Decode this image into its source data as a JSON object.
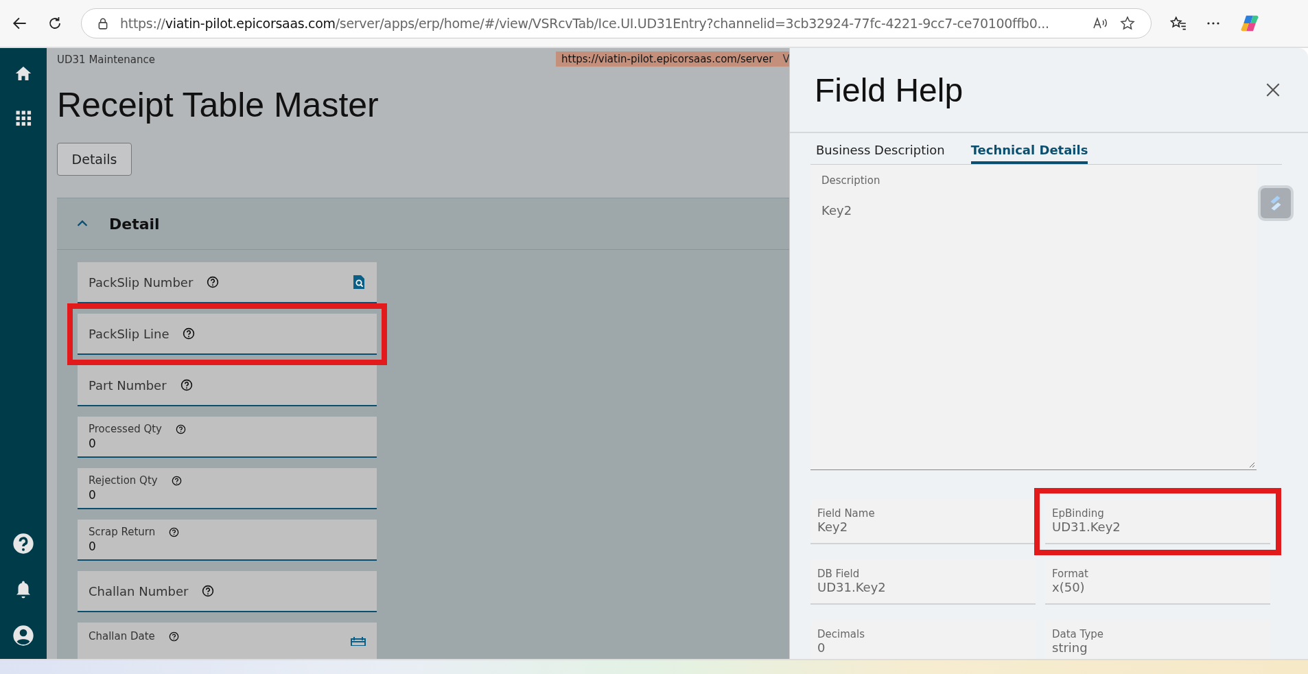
{
  "browser": {
    "url_scheme": "https://",
    "url_host": "viatin-pilot.epicorsaas.com",
    "url_path": "/server/apps/erp/home/#/view/VSRcvTab/Ice.UI.UD31Entry?channelid=3cb32924-77fc-4221-9cc7-ce70100ffb0..."
  },
  "link_tooltip": {
    "text": "https://viatin-pilot.epicorsaas.com/server",
    "cut_text": "V"
  },
  "page": {
    "breadcrumb": "UD31 Maintenance",
    "title": "Receipt Table Master",
    "button": "Details"
  },
  "panel": {
    "title": "Detail",
    "expanded": true
  },
  "fields": [
    {
      "label": "PackSlip Number",
      "kind": "lookup",
      "highlighted": false
    },
    {
      "label": "PackSlip Line",
      "kind": "text",
      "highlighted": true
    },
    {
      "label": "Part Number",
      "kind": "text",
      "highlighted": false
    },
    {
      "label": "Processed Qty",
      "kind": "number",
      "value": "0",
      "highlighted": false
    },
    {
      "label": "Rejection Qty",
      "kind": "number",
      "value": "0",
      "highlighted": false
    },
    {
      "label": "Scrap Return",
      "kind": "number",
      "value": "0",
      "highlighted": false
    },
    {
      "label": "Challan Number",
      "kind": "text",
      "highlighted": false
    },
    {
      "label": "Challan Date",
      "kind": "date",
      "highlighted": false
    }
  ],
  "field_help": {
    "title": "Field Help",
    "tabs": [
      {
        "label": "Business Description",
        "selected": false
      },
      {
        "label": "Technical Details",
        "selected": true
      }
    ],
    "description": {
      "label": "Description",
      "value": "Key2"
    },
    "details": [
      {
        "label": "Field Name",
        "value": "Key2",
        "highlighted": false
      },
      {
        "label": "EpBinding",
        "value": "UD31.Key2",
        "highlighted": true
      },
      {
        "label": "DB Field",
        "value": "UD31.Key2",
        "highlighted": false
      },
      {
        "label": "Format",
        "value": "x(50)",
        "highlighted": false
      },
      {
        "label": "Decimals",
        "value": "0",
        "highlighted": false
      },
      {
        "label": "Data Type",
        "value": "string",
        "highlighted": false
      }
    ]
  }
}
